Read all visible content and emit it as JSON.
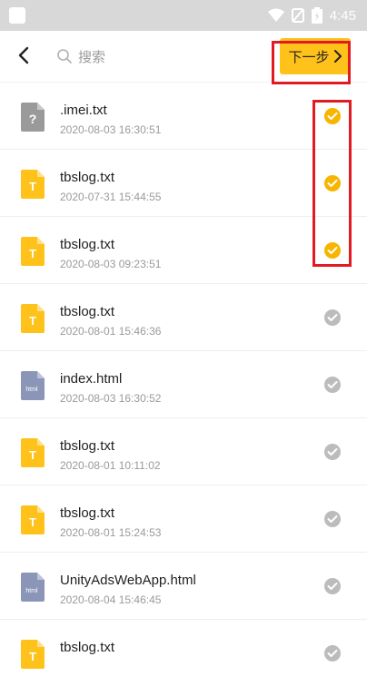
{
  "status": {
    "time": "4:45"
  },
  "header": {
    "search_placeholder": "搜索",
    "next_label": "下一步"
  },
  "files": [
    {
      "name": ".imei.txt",
      "time": "2020-08-03 16:30:51",
      "type": "unknown",
      "checked": true
    },
    {
      "name": "tbslog.txt",
      "time": "2020-07-31 15:44:55",
      "type": "txt",
      "checked": true
    },
    {
      "name": "tbslog.txt",
      "time": "2020-08-03 09:23:51",
      "type": "txt",
      "checked": true
    },
    {
      "name": "tbslog.txt",
      "time": "2020-08-01 15:46:36",
      "type": "txt",
      "checked": false
    },
    {
      "name": "index.html",
      "time": "2020-08-03 16:30:52",
      "type": "html",
      "checked": false
    },
    {
      "name": "tbslog.txt",
      "time": "2020-08-01 10:11:02",
      "type": "txt",
      "checked": false
    },
    {
      "name": "tbslog.txt",
      "time": "2020-08-01 15:24:53",
      "type": "txt",
      "checked": false
    },
    {
      "name": "UnityAdsWebApp.html",
      "time": "2020-08-04 15:46:45",
      "type": "html",
      "checked": false
    },
    {
      "name": "tbslog.txt",
      "time": "",
      "type": "txt",
      "checked": false
    }
  ],
  "icon_labels": {
    "unknown": "?",
    "txt": "T",
    "html": "html"
  },
  "colors": {
    "accent": "#ffc21a",
    "check_on": "#f7b500",
    "check_off": "#bcbcbc",
    "highlight": "#e11b22"
  }
}
